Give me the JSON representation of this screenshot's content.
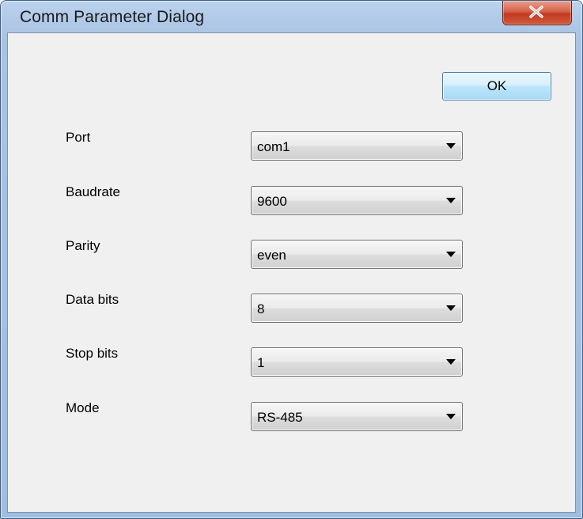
{
  "window": {
    "title": "Comm Parameter Dialog",
    "close_icon": "close-x-icon",
    "accent": "#c23a22"
  },
  "toolbar": {
    "ok_label": "OK"
  },
  "fields": [
    {
      "label": "Port",
      "value": "com1"
    },
    {
      "label": "Baudrate",
      "value": "9600"
    },
    {
      "label": "Parity",
      "value": "even"
    },
    {
      "label": "Data bits",
      "value": "8"
    },
    {
      "label": "Stop bits",
      "value": "1"
    },
    {
      "label": "Mode",
      "value": "RS-485"
    }
  ]
}
